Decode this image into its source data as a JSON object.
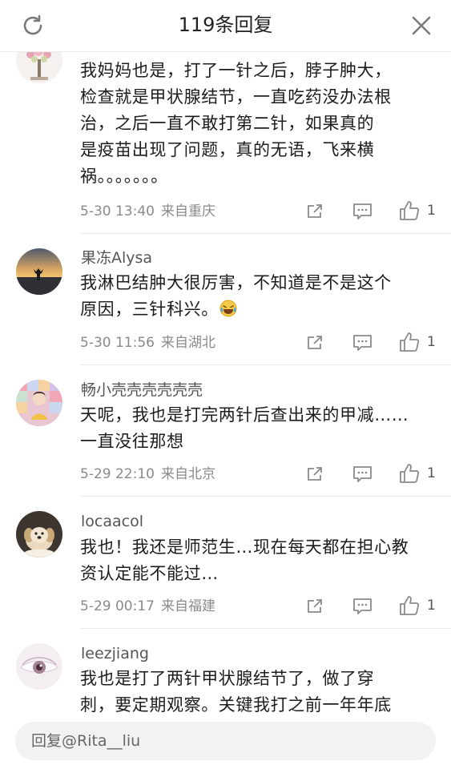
{
  "header": {
    "title": "119条回复",
    "refresh_icon": "refresh-icon",
    "close_icon": "close-icon"
  },
  "comments": [
    {
      "username": "",
      "lines": [
        "我妈妈也是，打了一针之后，脖子肿大，",
        "检查就是甲状腺结节，一直吃药没办法根",
        "治，之后一直不敢打第二针，如果真的",
        "是疫苗出现了问题，真的无语，飞来横",
        "祸。。。。。。。"
      ],
      "time": "5-30 13:40",
      "location": "来自重庆",
      "likes": "1"
    },
    {
      "username": "果冻Alysa",
      "lines": [
        "我淋巴结肿大很厉害，不知道是不是这个",
        "原因，三针科兴。"
      ],
      "emoji": "laughing-tears",
      "time": "5-30 11:56",
      "location": "来自湖北",
      "likes": "1"
    },
    {
      "username": "畅小壳壳壳壳壳壳",
      "lines": [
        "天呢，我也是打完两针后查出来的甲减……",
        "一直没往那想"
      ],
      "time": "5-29 22:10",
      "location": "来自北京",
      "likes": "1"
    },
    {
      "username": "locaacol",
      "lines": [
        "我也！我还是师范生…现在每天都在担心教",
        "资认定能不能过…"
      ],
      "time": "5-29 00:17",
      "location": "来自福建",
      "likes": "1"
    },
    {
      "username": "leezjiang",
      "lines": [
        "我也是打了两针甲状腺结节了，做了穿",
        "刺，要定期观察。关键我打之前一年年底"
      ],
      "time": "",
      "location": "",
      "likes": ""
    }
  ],
  "reply": {
    "placeholder": "回复@Rita__liu"
  },
  "colors": {
    "text": "#1c1c1c",
    "meta": "#8a8a8a",
    "icon": "#8a8a8a",
    "input_bg": "#f2f2f2"
  }
}
